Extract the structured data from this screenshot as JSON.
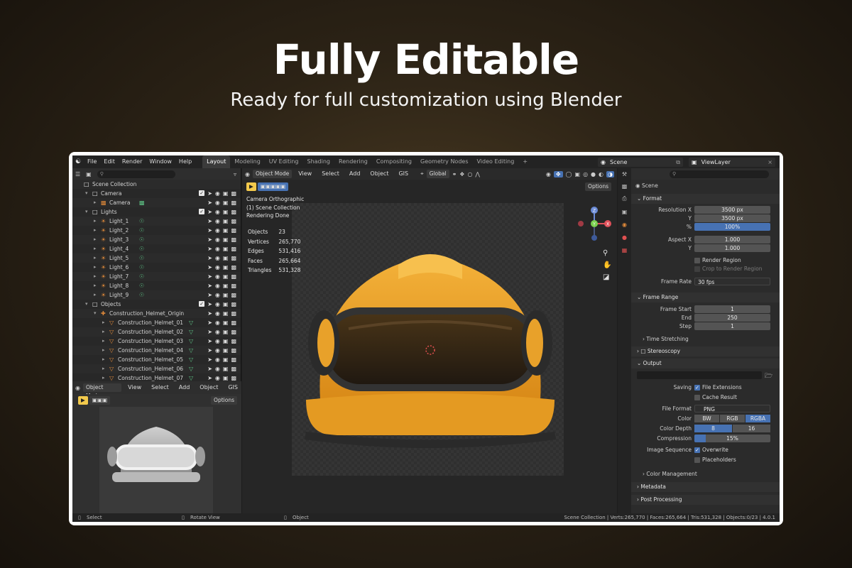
{
  "hero": {
    "title": "Fully Editable",
    "subtitle": "Ready for full customization using Blender"
  },
  "topbar": {
    "menus": [
      "File",
      "Edit",
      "Render",
      "Window",
      "Help"
    ],
    "workspaces": [
      "Layout",
      "Modeling",
      "UV Editing",
      "Shading",
      "Rendering",
      "Compositing",
      "Geometry Nodes",
      "Video Editing"
    ],
    "active_workspace": "Layout",
    "add_tab": "+",
    "scene": "Scene",
    "view_layer": "ViewLayer"
  },
  "outliner": {
    "items": [
      {
        "label": "Scene Collection",
        "depth": 0,
        "icon": "collection-icon"
      },
      {
        "label": "Camera",
        "depth": 1,
        "icon": "collection-icon"
      },
      {
        "label": "Camera",
        "depth": 2,
        "icon": "camera-object-icon"
      },
      {
        "label": "Lights",
        "depth": 1,
        "icon": "collection-icon"
      },
      {
        "label": "Light_1",
        "depth": 2,
        "icon": "light-icon"
      },
      {
        "label": "Light_2",
        "depth": 2,
        "icon": "light-icon"
      },
      {
        "label": "Light_3",
        "depth": 2,
        "icon": "light-icon"
      },
      {
        "label": "Light_4",
        "depth": 2,
        "icon": "light-icon"
      },
      {
        "label": "Light_5",
        "depth": 2,
        "icon": "light-icon"
      },
      {
        "label": "Light_6",
        "depth": 2,
        "icon": "light-icon"
      },
      {
        "label": "Light_7",
        "depth": 2,
        "icon": "light-icon"
      },
      {
        "label": "Light_8",
        "depth": 2,
        "icon": "light-icon"
      },
      {
        "label": "Light_9",
        "depth": 2,
        "icon": "light-icon"
      },
      {
        "label": "Objects",
        "depth": 1,
        "icon": "collection-icon"
      },
      {
        "label": "Construction_Helmet_Origin",
        "depth": 2,
        "icon": "empty-icon"
      },
      {
        "label": "Construction_Helmet_01",
        "depth": 3,
        "icon": "mesh-icon"
      },
      {
        "label": "Construction_Helmet_02",
        "depth": 3,
        "icon": "mesh-icon"
      },
      {
        "label": "Construction_Helmet_03",
        "depth": 3,
        "icon": "mesh-icon"
      },
      {
        "label": "Construction_Helmet_04",
        "depth": 3,
        "icon": "mesh-icon"
      },
      {
        "label": "Construction_Helmet_05",
        "depth": 3,
        "icon": "mesh-icon"
      },
      {
        "label": "Construction_Helmet_06",
        "depth": 3,
        "icon": "mesh-icon"
      },
      {
        "label": "Construction_Helmet_07",
        "depth": 3,
        "icon": "mesh-icon"
      }
    ]
  },
  "small_viewport": {
    "mode": "Object Mode",
    "menus": [
      "View",
      "Select",
      "Add",
      "Object",
      "GIS"
    ],
    "options": "Options"
  },
  "viewport": {
    "mode": "Object Mode",
    "menus": [
      "View",
      "Select",
      "Add",
      "Object",
      "GIS"
    ],
    "orientation": "Global",
    "options": "Options",
    "info_lines": [
      "Camera Orthographic",
      "(1) Scene Collection",
      "Rendering Done"
    ],
    "stats": [
      {
        "label": "Objects",
        "value": "23"
      },
      {
        "label": "Vertices",
        "value": "265,770"
      },
      {
        "label": "Edges",
        "value": "531,416"
      },
      {
        "label": "Faces",
        "value": "265,664"
      },
      {
        "label": "Triangles",
        "value": "531,328"
      }
    ],
    "gizmo_axes": {
      "x": "X",
      "y": "Y",
      "z": "Z"
    }
  },
  "properties": {
    "context": "Scene",
    "format": {
      "title": "Format",
      "resolution_x_label": "Resolution X",
      "resolution_x": "3500 px",
      "resolution_y_label": "Y",
      "resolution_y": "3500 px",
      "percent_label": "%",
      "percent": "100%",
      "aspect_x_label": "Aspect X",
      "aspect_x": "1.000",
      "aspect_y_label": "Y",
      "aspect_y": "1.000",
      "render_region": "Render Region",
      "crop_region": "Crop to Render Region",
      "frame_rate_label": "Frame Rate",
      "frame_rate": "30 fps"
    },
    "frame_range": {
      "title": "Frame Range",
      "start_label": "Frame Start",
      "start": "1",
      "end_label": "End",
      "end": "250",
      "step_label": "Step",
      "step": "1",
      "time_stretching": "Time Stretching"
    },
    "stereoscopy": "Stereoscopy",
    "output": {
      "title": "Output",
      "path": "",
      "saving_label": "Saving",
      "file_extensions": "File Extensions",
      "cache_result": "Cache Result",
      "file_format_label": "File Format",
      "file_format": "PNG",
      "color_label": "Color",
      "color_options": [
        "BW",
        "RGB",
        "RGBA"
      ],
      "color_selected": "RGBA",
      "depth_label": "Color Depth",
      "depth_options": [
        "8",
        "16"
      ],
      "depth_selected": "8",
      "compression_label": "Compression",
      "compression": "15%",
      "compression_fraction": 0.15,
      "image_sequence_label": "Image Sequence",
      "overwrite": "Overwrite",
      "placeholders": "Placeholders",
      "color_management": "Color Management"
    },
    "metadata": "Metadata",
    "post_processing": "Post Processing"
  },
  "statusbar": {
    "select": "Select",
    "rotate": "Rotate View",
    "object": "Object",
    "summary": "Scene Collection | Verts:265,770 | Faces:265,664 | Tris:531,328 | Objects:0/23 | 4.0.1"
  },
  "colors": {
    "accent_blue": "#4772b3",
    "helmet_yellow": "#e8a12a",
    "light_green": "#5ec486",
    "mesh_orange": "#e08a3a"
  }
}
